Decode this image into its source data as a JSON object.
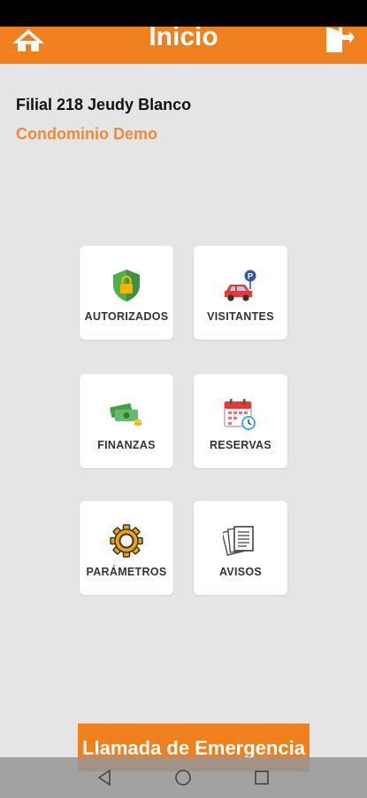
{
  "header": {
    "title": "Inicio",
    "home_icon": "home-icon",
    "logout_icon": "logout-door-icon"
  },
  "info": {
    "filial": "Filial 218 Jeudy Blanco",
    "condominio": "Condominio Demo"
  },
  "menu": [
    {
      "label": "AUTORIZADOS",
      "icon": "shield-check-icon"
    },
    {
      "label": "VISITANTES",
      "icon": "car-parking-icon"
    },
    {
      "label": "FINANZAS",
      "icon": "money-icon"
    },
    {
      "label": "RESERVAS",
      "icon": "calendar-clock-icon"
    },
    {
      "label": "PARÁMETROS",
      "icon": "gear-icon"
    },
    {
      "label": "AVISOS",
      "icon": "documents-icon"
    }
  ],
  "emergency": {
    "label": "Llamada de Emergencia"
  },
  "colors": {
    "primary": "#f07f1e",
    "accent_text": "#ef8a3c",
    "background": "#e5e5e5"
  },
  "system_nav": [
    "back-icon",
    "home-circle-icon",
    "recents-icon"
  ]
}
